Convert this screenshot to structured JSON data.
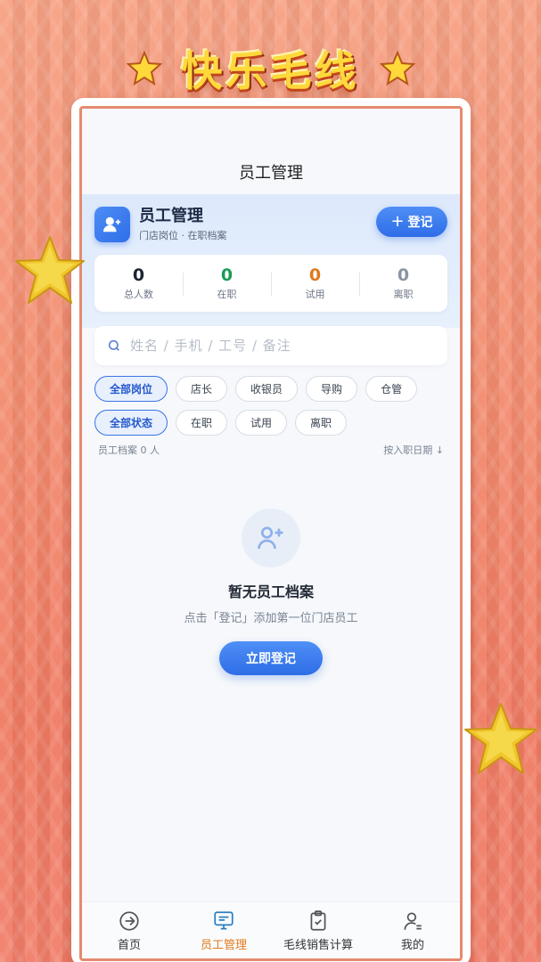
{
  "banner": {
    "title": "快乐毛线"
  },
  "header": {
    "title": "员工管理"
  },
  "hero": {
    "title": "员工管理",
    "subtitle": "门店岗位 · 在职档案",
    "register_label": "登记"
  },
  "stats": [
    {
      "value": "0",
      "label": "总人数",
      "color": "#1d2433"
    },
    {
      "value": "0",
      "label": "在职",
      "color": "#1a9b55"
    },
    {
      "value": "0",
      "label": "试用",
      "color": "#e07a1c"
    },
    {
      "value": "0",
      "label": "离职",
      "color": "#8b93a3"
    }
  ],
  "search": {
    "placeholder": "姓名 / 手机 / 工号 / 备注"
  },
  "position_filters": [
    "全部岗位",
    "店长",
    "收银员",
    "导购",
    "仓管"
  ],
  "status_filters": [
    "全部状态",
    "在职",
    "试用",
    "离职"
  ],
  "list_meta": {
    "count_text": "员工档案 0 人",
    "sort_text": "按入职日期 ↓"
  },
  "empty": {
    "title": "暂无员工档案",
    "subtitle": "点击「登记」添加第一位门店员工",
    "cta_label": "立即登记"
  },
  "tabs": [
    {
      "label": "首页",
      "icon": "arrow-circle-icon",
      "active": false
    },
    {
      "label": "员工管理",
      "icon": "monitor-icon",
      "active": true
    },
    {
      "label": "毛线销售计算",
      "icon": "clipboard-check-icon",
      "active": false
    },
    {
      "label": "我的",
      "icon": "user-icon",
      "active": false
    }
  ],
  "colors": {
    "accent": "#2e6de6",
    "active_tab": "#e07a1c",
    "frame": "#e58a6f"
  }
}
